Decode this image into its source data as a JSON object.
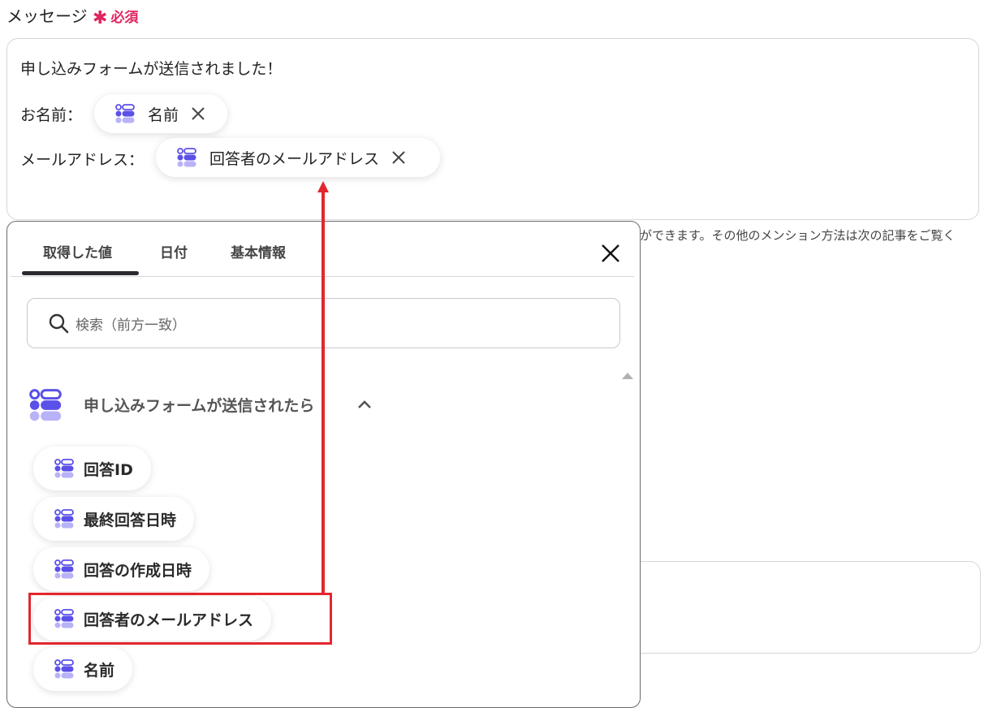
{
  "field": {
    "label": "メッセージ",
    "required_label": "必須"
  },
  "message": {
    "line1": "申し込みフォームが送信されました！",
    "name_prefix": "お名前：",
    "email_prefix": "メールアドレス：",
    "name_chip": "名前",
    "email_chip": "回答者のメールアドレス"
  },
  "hint_text": "ができます。その他のメンション方法は次の記事をご覧く",
  "popup": {
    "tabs": [
      "取得した値",
      "日付",
      "基本情報"
    ],
    "active_tab": 0,
    "search_placeholder": "検索（前方一致）",
    "group_label": "申し込みフォームが送信されたら",
    "items": [
      "回答ID",
      "最終回答日時",
      "回答の作成日時",
      "回答者のメールアドレス",
      "名前"
    ],
    "highlighted_item": 3
  },
  "colors": {
    "required": "#e0245e",
    "annotation": "#e3262e",
    "icon_primary": "#5b50e8",
    "icon_light": "#b8b2f7"
  }
}
